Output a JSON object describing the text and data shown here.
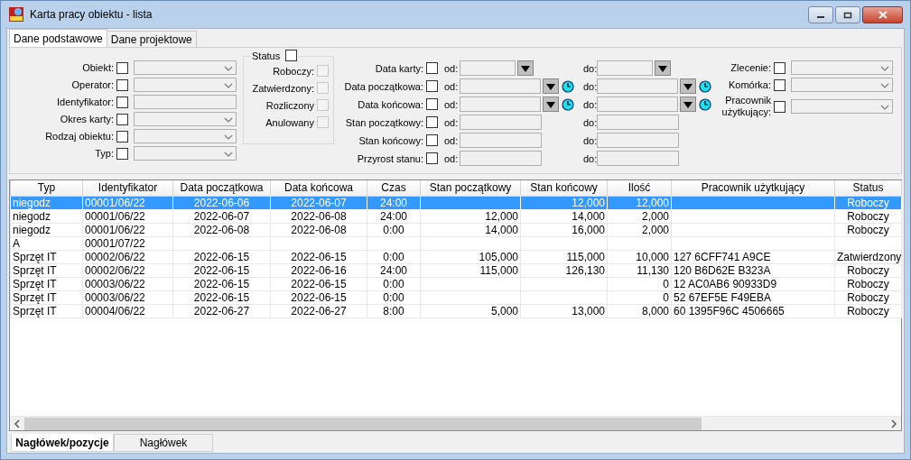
{
  "window": {
    "title": "Karta pracy obiektu - lista"
  },
  "tabs": [
    {
      "label": "Dane podstawowe",
      "selected": true
    },
    {
      "label": "Dane projektowe",
      "selected": false
    }
  ],
  "filters": {
    "left": [
      {
        "label": "Obiekt:",
        "checked": false,
        "kind": "combo"
      },
      {
        "label": "Operator:",
        "checked": false,
        "kind": "combo"
      },
      {
        "label": "Identyfikator:",
        "checked": false,
        "kind": "text"
      },
      {
        "label": "Okres karty:",
        "checked": false,
        "kind": "combo"
      },
      {
        "label": "Rodzaj obiektu:",
        "checked": false,
        "kind": "combo"
      },
      {
        "label": "Typ:",
        "checked": false,
        "kind": "combo"
      }
    ],
    "status": {
      "label": "Status",
      "checked": false,
      "options": [
        {
          "label": "Roboczy:",
          "checked": false,
          "disabled": true
        },
        {
          "label": "Zatwierdzony:",
          "checked": false,
          "disabled": true
        },
        {
          "label": "Rozliczony",
          "checked": false,
          "disabled": true
        },
        {
          "label": "Anulowany",
          "checked": false,
          "disabled": true
        }
      ]
    },
    "ranges": [
      {
        "label": "Data karty:",
        "checked": false,
        "kind": "date",
        "from_label": "od:",
        "to_label": "do:"
      },
      {
        "label": "Data początkowa:",
        "checked": false,
        "kind": "datetime",
        "from_label": "od:",
        "to_label": "do:"
      },
      {
        "label": "Data końcowa:",
        "checked": false,
        "kind": "datetime",
        "from_label": "od:",
        "to_label": "do:"
      },
      {
        "label": "Stan początkowy:",
        "checked": false,
        "kind": "number",
        "from_label": "od:",
        "to_label": "do:"
      },
      {
        "label": "Stan końcowy:",
        "checked": false,
        "kind": "number",
        "from_label": "od:",
        "to_label": "do:"
      },
      {
        "label": "Przyrost stanu:",
        "checked": false,
        "kind": "number",
        "from_label": "od:",
        "to_label": "do:"
      }
    ],
    "right": [
      {
        "label": "Zlecenie:",
        "checked": false,
        "kind": "combo"
      },
      {
        "label": "Komórka:",
        "checked": false,
        "kind": "combo"
      },
      {
        "label": "Pracownik użytkujący:",
        "checked": false,
        "kind": "combo"
      }
    ]
  },
  "table": {
    "columns": [
      {
        "label": "Typ",
        "kind": "text"
      },
      {
        "label": "Identyfikator",
        "kind": "text"
      },
      {
        "label": "Data początkowa",
        "kind": "date"
      },
      {
        "label": "Data końcowa",
        "kind": "date"
      },
      {
        "label": "Czas",
        "kind": "time"
      },
      {
        "label": "Stan początkowy",
        "kind": "number"
      },
      {
        "label": "Stan końcowy",
        "kind": "number"
      },
      {
        "label": "Ilość",
        "kind": "number"
      },
      {
        "label": "Pracownik użytkujący",
        "kind": "text"
      },
      {
        "label": "Status",
        "kind": "status"
      }
    ],
    "rows": [
      {
        "selected": true,
        "cells": [
          "niegodz",
          "00001/06/22",
          "2022-06-06",
          "2022-06-07",
          "24:00",
          "",
          "12,000",
          "12,000",
          "",
          "Roboczy"
        ]
      },
      {
        "selected": false,
        "cells": [
          "niegodz",
          "00001/06/22",
          "2022-06-07",
          "2022-06-08",
          "24:00",
          "12,000",
          "14,000",
          "2,000",
          "",
          "Roboczy"
        ]
      },
      {
        "selected": false,
        "cells": [
          "niegodz",
          "00001/06/22",
          "2022-06-08",
          "2022-06-08",
          "0:00",
          "14,000",
          "16,000",
          "2,000",
          "",
          "Roboczy"
        ]
      },
      {
        "selected": false,
        "cells": [
          "A",
          "00001/07/22",
          "",
          "",
          "",
          "",
          "",
          "",
          "",
          ""
        ]
      },
      {
        "selected": false,
        "cells": [
          "Sprzęt IT",
          "00002/06/22",
          "2022-06-15",
          "2022-06-15",
          "0:00",
          "105,000",
          "115,000",
          "10,000",
          "127 6CFF741 A9CE",
          "Zatwierdzony"
        ]
      },
      {
        "selected": false,
        "cells": [
          "Sprzęt IT",
          "00002/06/22",
          "2022-06-15",
          "2022-06-16",
          "24:00",
          "115,000",
          "126,130",
          "11,130",
          "120 B6D62E B323A",
          "Roboczy"
        ]
      },
      {
        "selected": false,
        "cells": [
          "Sprzęt IT",
          "00003/06/22",
          "2022-06-15",
          "2022-06-15",
          "0:00",
          "",
          "",
          "0",
          "12 AC0AB6 90933D9",
          "Roboczy"
        ]
      },
      {
        "selected": false,
        "cells": [
          "Sprzęt IT",
          "00003/06/22",
          "2022-06-15",
          "2022-06-15",
          "0:00",
          "",
          "",
          "0",
          "52 67EF5E F49EBA",
          "Roboczy"
        ]
      },
      {
        "selected": false,
        "cells": [
          "Sprzęt IT",
          "00004/06/22",
          "2022-06-27",
          "2022-06-27",
          "8:00",
          "5,000",
          "13,000",
          "8,000",
          "60 1395F96C 4506665",
          "Roboczy"
        ]
      }
    ]
  },
  "bottom_tabs": [
    {
      "label": "Nagłówek/pozycje",
      "selected": true
    },
    {
      "label": "Nagłówek",
      "selected": false
    }
  ]
}
